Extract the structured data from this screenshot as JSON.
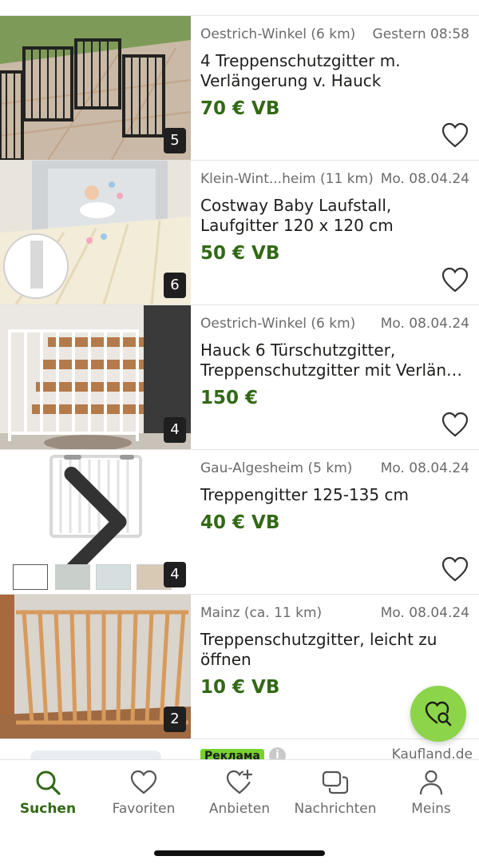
{
  "listings": [
    {
      "location": "Oestrich-Winkel (6 km)",
      "date": "Gestern 08:58",
      "title": "4 Treppenschutzgitter m. Verlängerung v. Hauck",
      "price": "70 € VB",
      "image_count": "5"
    },
    {
      "location": "Klein-Wint...heim (11 km)",
      "date": "Mo. 08.04.24",
      "title": "Costway Baby Laufstall, Laufgitter 120 x 120 cm",
      "price": "50 € VB",
      "image_count": "6"
    },
    {
      "location": "Oestrich-Winkel (6 km)",
      "date": "Mo. 08.04.24",
      "title": "Hauck 6 Türschutzgitter, Treppenschutzgitter mit Verlän…",
      "price": "150 €",
      "image_count": "4"
    },
    {
      "location": "Gau-Algesheim (5 km)",
      "date": "Mo. 08.04.24",
      "title": "Treppengitter 125-135 cm",
      "price": "40 € VB",
      "image_count": "4"
    },
    {
      "location": "Mainz (ca. 11 km)",
      "date": "Mo. 08.04.24",
      "title": "Treppenschutzgitter, leicht zu öffnen",
      "price": "10 € VB",
      "image_count": "2"
    }
  ],
  "ad": {
    "badge": "Реклама",
    "info": "i",
    "brand": "Kaufland.de"
  },
  "tabs": [
    {
      "label": "Suchen",
      "icon": "search-icon",
      "active": true
    },
    {
      "label": "Favoriten",
      "icon": "heart-icon",
      "active": false
    },
    {
      "label": "Anbieten",
      "icon": "heart-plus-icon",
      "active": false
    },
    {
      "label": "Nachrichten",
      "icon": "messages-icon",
      "active": false
    },
    {
      "label": "Meins",
      "icon": "person-icon",
      "active": false
    }
  ],
  "fab_icon": "saved-search-icon",
  "colors": {
    "accent_green": "#326916",
    "fab_green": "#8cd449",
    "ad_badge": "#76d22d",
    "text_muted": "#6b6b6b"
  }
}
